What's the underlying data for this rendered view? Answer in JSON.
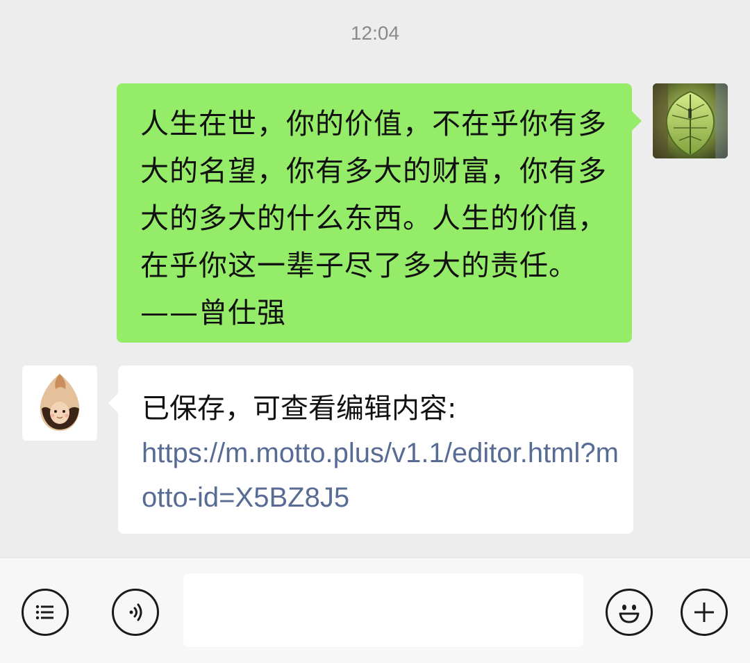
{
  "chat": {
    "timestamp": "12:04",
    "messages": [
      {
        "sender": "self",
        "avatar": "leaf-photo",
        "text": "人生在世，你的价值，不在乎你有多大的名望，你有多大的财富，你有多大的多大的什么东西。人生的价值，在乎你这一辈子尽了多大的责任。——曾仕强"
      },
      {
        "sender": "bot",
        "avatar": "seed-character-icon",
        "text": "已保存，可查看编辑内容:",
        "link": "https://m.motto.plus/v1.1/editor.html?motto-id=X5BZ8J5"
      }
    ]
  },
  "toolbar": {
    "left_icons": [
      "list-icon",
      "voice-icon"
    ],
    "right_icons": [
      "emoji-icon",
      "plus-icon"
    ],
    "input_value": ""
  },
  "colors": {
    "background": "#ededed",
    "sent_bubble": "#95ec69",
    "received_bubble": "#ffffff",
    "link": "#576b95",
    "timestamp": "#8a8a8a"
  }
}
